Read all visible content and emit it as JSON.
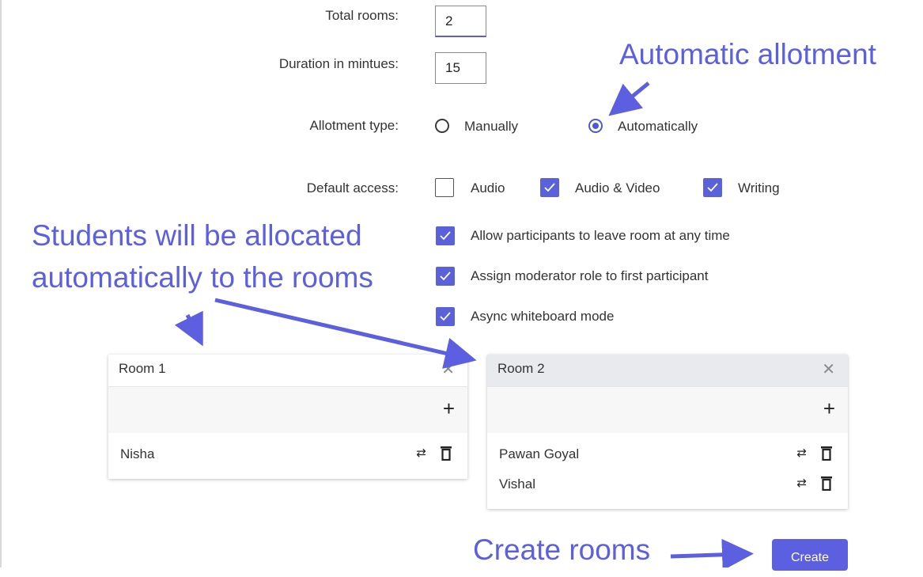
{
  "form": {
    "total_rooms_label": "Total rooms:",
    "total_rooms_value": "2",
    "duration_label": "Duration in mintues:",
    "duration_value": "15",
    "allotment_label": "Allotment type:",
    "allotment_options": [
      "Manually",
      "Automatically"
    ],
    "allotment_selected": "Automatically",
    "default_access_label": "Default access:",
    "access_options": [
      {
        "label": "Audio",
        "checked": false
      },
      {
        "label": "Audio & Video",
        "checked": true
      },
      {
        "label": "Writing",
        "checked": true
      }
    ],
    "settings": [
      {
        "label": "Allow participants to leave room at any time",
        "checked": true
      },
      {
        "label": "Assign moderator role to first participant",
        "checked": true
      },
      {
        "label": "Async whiteboard mode",
        "checked": true
      }
    ]
  },
  "rooms": [
    {
      "title": "Room 1",
      "participants": [
        "Nisha"
      ]
    },
    {
      "title": "Room 2",
      "participants": [
        "Pawan Goyal",
        "Vishal"
      ]
    }
  ],
  "create_label": "Create",
  "annotations": {
    "automatic_allotment": "Automatic allotment",
    "students_line1": "Students will be allocated",
    "students_line2": "automatically to the rooms",
    "create_rooms": "Create rooms"
  },
  "colors": {
    "accent": "#5b5fe0",
    "checkbox": "#5b62d9"
  }
}
